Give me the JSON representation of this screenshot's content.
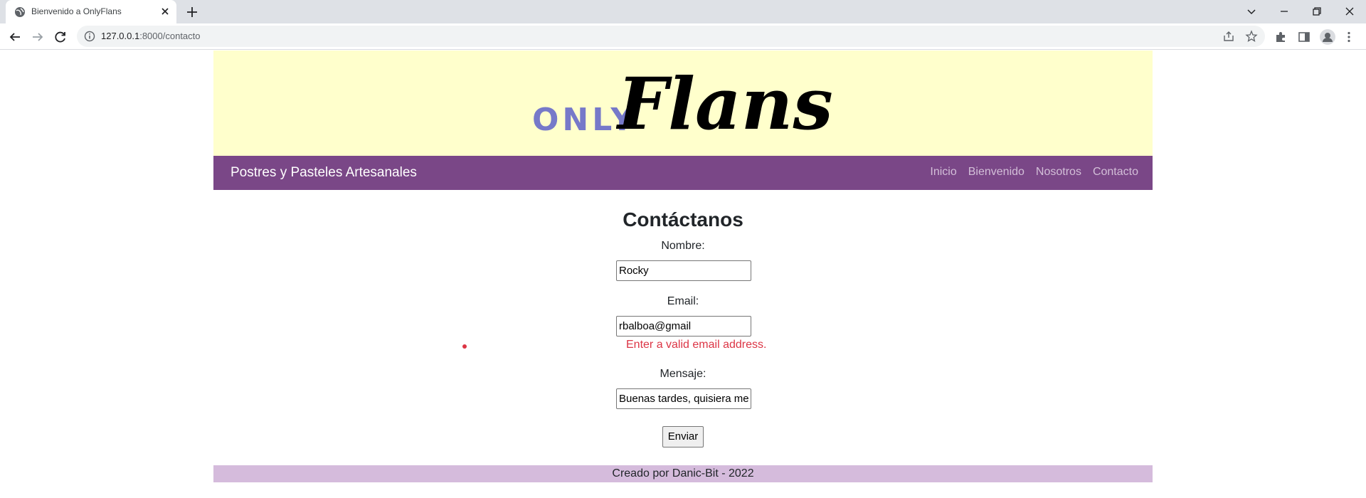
{
  "browser": {
    "tab_title": "Bienvenido a OnlyFlans",
    "url_host": "127.0.0.1",
    "url_path": ":8000/contacto"
  },
  "logo": {
    "only": "ONLY",
    "flans": "Flans",
    "colors": {
      "only": "#7679c9",
      "flans": "#000000",
      "banner_bg": "#ffffcc"
    }
  },
  "nav": {
    "brand": "Postres y Pasteles Artesanales",
    "links": [
      "Inicio",
      "Bienvenido",
      "Nosotros",
      "Contacto"
    ],
    "colors": {
      "bar": "#7a4787",
      "link": "#d3bfd8"
    }
  },
  "form": {
    "heading": "Contáctanos",
    "name_label": "Nombre:",
    "name_value": "Rocky",
    "email_label": "Email:",
    "email_value": "rbalboa@gmail",
    "email_error": "Enter a valid email address.",
    "message_label": "Mensaje:",
    "message_value": "Buenas tardes, quisiera me",
    "submit_label": "Enviar",
    "error_color": "#dc3545"
  },
  "footer": {
    "text": "Creado por Danic-Bit - 2022",
    "bg": "#d5bbdc"
  }
}
